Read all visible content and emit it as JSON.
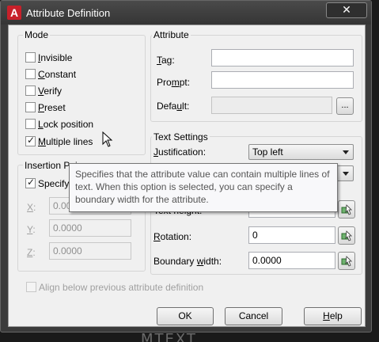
{
  "window": {
    "title": "Attribute Definition",
    "close_glyph": "✕"
  },
  "mode": {
    "group_label": "Mode",
    "options": [
      {
        "label": "Invisible",
        "checked": false
      },
      {
        "label": "Constant",
        "checked": false
      },
      {
        "label": "Verify",
        "checked": false
      },
      {
        "label": "Preset",
        "checked": false
      },
      {
        "label": "Lock position",
        "checked": false
      },
      {
        "label": "Multiple lines",
        "checked": true
      }
    ]
  },
  "attribute": {
    "group_label": "Attribute",
    "tag_label": "Tag:",
    "prompt_label": "Prompt:",
    "default_label": "Default:",
    "tag_value": "",
    "prompt_value": "",
    "default_value": "",
    "browse_label": "..."
  },
  "insertion": {
    "group_label": "Insertion Poi",
    "specify_label": "Specify o",
    "specify_checked": true,
    "x_label": "X:",
    "y_label": "Y:",
    "z_label": "Z:",
    "x_value": "0.0000",
    "y_value": "0.0000",
    "z_value": "0.0000"
  },
  "text_settings": {
    "group_label": "Text Settings",
    "justification_label": "Justification:",
    "justification_value": "Top left",
    "rotation_label": "Rotation:",
    "rotation_value": "0",
    "boundary_label": "Boundary width:",
    "boundary_value": "0.0000",
    "partial_label": "Text height:"
  },
  "align_label": "Align below previous attribute definition",
  "buttons": {
    "ok": "OK",
    "cancel": "Cancel",
    "help": "Help"
  },
  "tooltip": {
    "text": "Specifies that the attribute value can contain multiple lines of text. When this option is selected, you can specify a boundary width for the attribute."
  },
  "background_text": "MTEXT",
  "colors": {
    "title_bar": "#3b3b3b",
    "app_logo": "#c8202a",
    "dialog_bg": "#f0f0f0"
  }
}
